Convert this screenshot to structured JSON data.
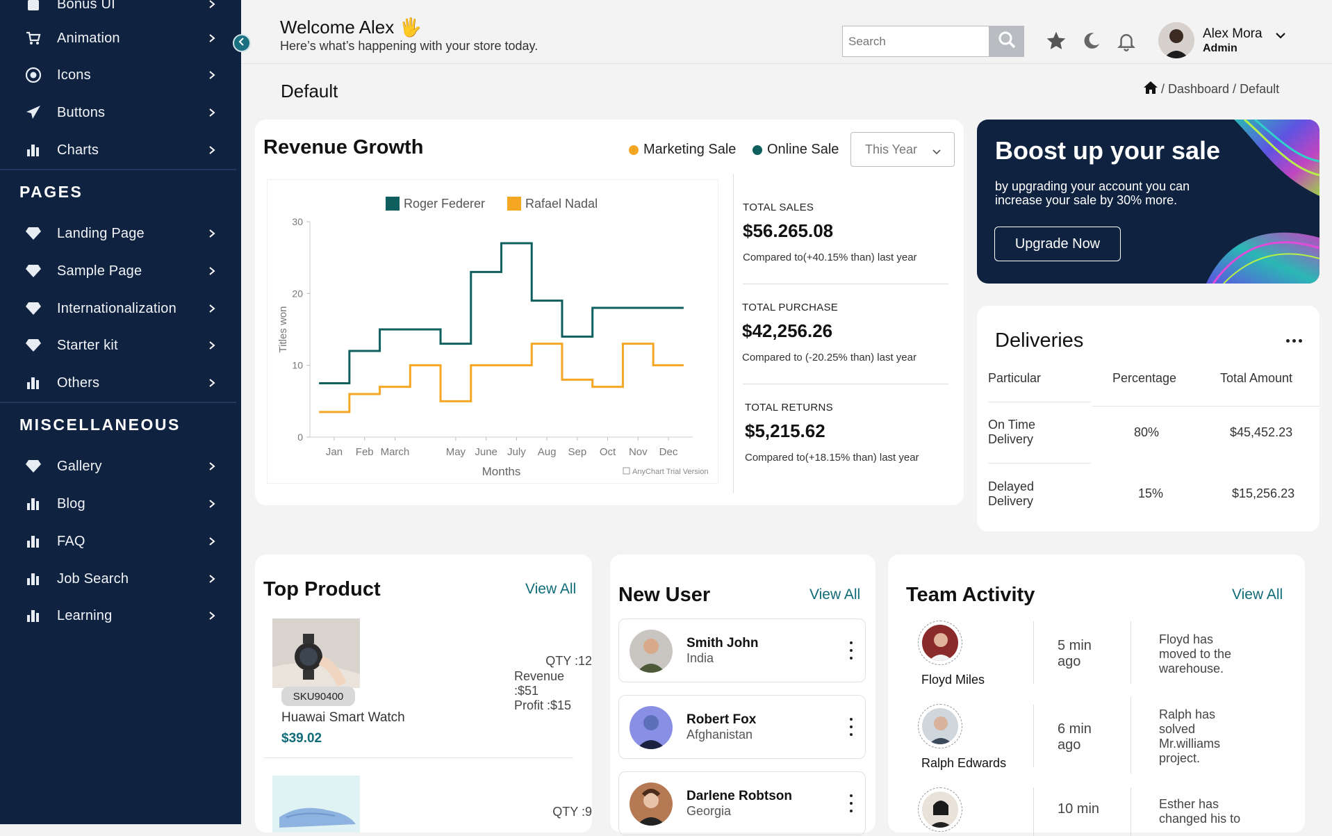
{
  "sidebar": {
    "items_top": [
      {
        "label": "Bonus UI",
        "icon": "bag-icon"
      },
      {
        "label": "Animation",
        "icon": "cart-icon"
      },
      {
        "label": "Icons",
        "icon": "target-icon"
      },
      {
        "label": "Buttons",
        "icon": "paper-plane-icon"
      },
      {
        "label": "Charts",
        "icon": "bar-chart-icon"
      }
    ],
    "section_pages": "PAGES",
    "pages": [
      {
        "label": "Landing Page",
        "icon": "diamond-icon"
      },
      {
        "label": "Sample Page",
        "icon": "diamond-icon"
      },
      {
        "label": "Internationalization",
        "icon": "diamond-icon"
      },
      {
        "label": "Starter kit",
        "icon": "diamond-icon"
      },
      {
        "label": "Others",
        "icon": "bar-chart-icon"
      }
    ],
    "section_misc": "MISCELLANEOUS",
    "misc": [
      {
        "label": "Gallery",
        "icon": "diamond-icon"
      },
      {
        "label": "Blog",
        "icon": "bar-chart-icon"
      },
      {
        "label": "FAQ",
        "icon": "bar-chart-icon"
      },
      {
        "label": "Job Search",
        "icon": "bar-chart-icon"
      },
      {
        "label": "Learning",
        "icon": "bar-chart-icon"
      }
    ]
  },
  "header": {
    "welcome": "Welcome Alex 🖐",
    "subtitle": "Here’s what’s happening with your store today.",
    "search_placeholder": "Search",
    "user_name": "Alex Mora",
    "user_role": "Admin"
  },
  "page": {
    "title": "Default",
    "breadcrumb": "/ Dashboard / Default"
  },
  "revenue": {
    "title": "Revenue Growth",
    "legend_marketing": "Marketing Sale",
    "legend_online": "Online Sale",
    "period": "This Year",
    "stats": [
      {
        "label": "TOTAL SALES",
        "value": "$56.265.08",
        "compare": "Compared to(+40.15% than) last year"
      },
      {
        "label": "TOTAL PURCHASE",
        "value": "$42,256.26",
        "compare": "Compared to (-20.25% than) last year"
      },
      {
        "label": "TOTAL RETURNS",
        "value": "$5,215.62",
        "compare": "Compared to(+18.15% than) last year"
      }
    ]
  },
  "chart_data": {
    "type": "line",
    "title": "",
    "xlabel": "Months",
    "ylabel": "Titles won",
    "ylim": [
      0,
      30
    ],
    "yticks": [
      0,
      10,
      20,
      30
    ],
    "x": [
      "Jan",
      "Feb",
      "March",
      "May",
      "June",
      "July",
      "Aug",
      "Sep",
      "Oct",
      "Nov",
      "Dec"
    ],
    "x_positions": [
      0,
      1,
      2,
      4,
      5,
      6,
      7,
      8,
      9,
      10,
      11
    ],
    "step": true,
    "series": [
      {
        "name": "Roger Federer",
        "color": "#0f5f5f",
        "values": [
          [
            -0.5,
            7.5
          ],
          [
            0.5,
            12
          ],
          [
            1.5,
            15
          ],
          [
            3.5,
            13
          ],
          [
            4.5,
            23
          ],
          [
            5.5,
            27
          ],
          [
            6.5,
            19
          ],
          [
            7.5,
            14
          ],
          [
            8.5,
            18
          ],
          [
            11.5,
            18
          ]
        ]
      },
      {
        "name": "Rafael Nadal",
        "color": "#f5a623",
        "values": [
          [
            -0.5,
            3.5
          ],
          [
            0.5,
            6
          ],
          [
            1.5,
            7
          ],
          [
            2.5,
            10
          ],
          [
            3.5,
            5
          ],
          [
            4.5,
            10
          ],
          [
            6.5,
            13
          ],
          [
            7.5,
            8
          ],
          [
            8.5,
            7
          ],
          [
            9.5,
            13
          ],
          [
            10.5,
            10
          ],
          [
            11.5,
            10
          ]
        ]
      }
    ],
    "credit": "AnyChart Trial Version",
    "legend": "top"
  },
  "boost": {
    "title": "Boost up your sale",
    "subtitle": "by upgrading your account you can increase your sale by 30% more.",
    "button": "Upgrade Now"
  },
  "deliveries": {
    "title": "Deliveries",
    "headers": [
      "Particular",
      "Percentage",
      "Total Amount"
    ],
    "rows": [
      {
        "particular": "On Time Delivery",
        "percentage": "80%",
        "amount": "$45,452.23"
      },
      {
        "particular": "Delayed Delivery",
        "percentage": "15%",
        "amount": "$15,256.23"
      }
    ]
  },
  "top_product": {
    "title": "Top Product",
    "view_all": "View All",
    "items": [
      {
        "sku": "SKU90400",
        "name": "Huawai Smart Watch",
        "price": "$39.02",
        "qty": "QTY :12",
        "revenue": "Revenue :$51",
        "profit": "Profit :$15"
      },
      {
        "qty": "QTY :9"
      }
    ]
  },
  "new_user": {
    "title": "New User",
    "view_all": "View All",
    "users": [
      {
        "name": "Smith John",
        "country": "India"
      },
      {
        "name": "Robert Fox",
        "country": "Afghanistan"
      },
      {
        "name": "Darlene Robtson",
        "country": "Georgia"
      }
    ]
  },
  "team": {
    "title": "Team Activity",
    "view_all": "View All",
    "rows": [
      {
        "name": "Floyd Miles",
        "time": "5 min ago",
        "activity": "Floyd has moved to the warehouse."
      },
      {
        "name": "Ralph Edwards",
        "time": "6 min ago",
        "activity": "Ralph has solved Mr.williams project."
      },
      {
        "name": "",
        "time": "10 min",
        "activity": "Esther has changed his to"
      }
    ]
  }
}
